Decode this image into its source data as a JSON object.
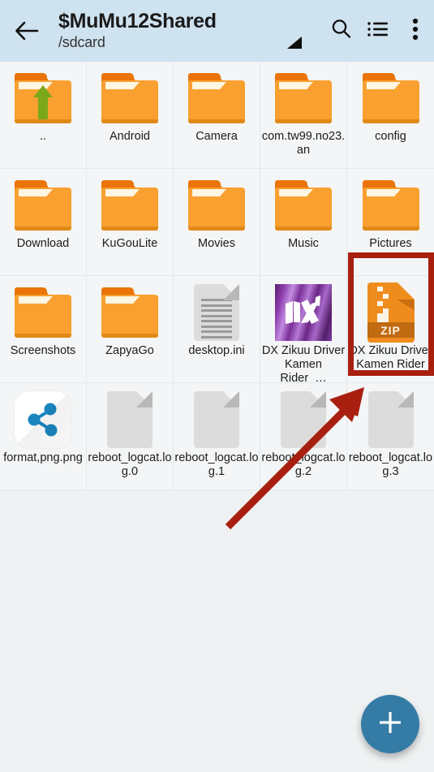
{
  "header": {
    "back_icon": "arrow-left-icon",
    "title": "$MuMu12Shared",
    "subtitle": "/sdcard",
    "search_icon": "search-icon",
    "list_view_icon": "list-view-icon",
    "overflow_icon": "more-vertical-icon",
    "background_color": "#cfe2f0"
  },
  "grid": {
    "columns": 5,
    "items": [
      {
        "label": "..",
        "icon": "folder-up-icon",
        "type": "folder-parent"
      },
      {
        "label": "Android",
        "icon": "folder-icon",
        "type": "folder"
      },
      {
        "label": "Camera",
        "icon": "folder-icon",
        "type": "folder"
      },
      {
        "label": "com.tw99.no23.an",
        "icon": "folder-icon",
        "type": "folder"
      },
      {
        "label": "config",
        "icon": "folder-icon",
        "type": "folder"
      },
      {
        "label": "Download",
        "icon": "folder-icon",
        "type": "folder"
      },
      {
        "label": "KuGouLite",
        "icon": "folder-icon",
        "type": "folder"
      },
      {
        "label": "Movies",
        "icon": "folder-icon",
        "type": "folder"
      },
      {
        "label": "Music",
        "icon": "folder-icon",
        "type": "folder"
      },
      {
        "label": "Pictures",
        "icon": "folder-icon",
        "type": "folder"
      },
      {
        "label": "Screenshots",
        "icon": "folder-icon",
        "type": "folder"
      },
      {
        "label": "ZapyaGo",
        "icon": "folder-icon",
        "type": "folder"
      },
      {
        "label": "desktop.ini",
        "icon": "text-file-icon",
        "type": "file"
      },
      {
        "label": "DX Zikuu Driver Kamen Rider_…",
        "icon": "image-thumbnail",
        "type": "image"
      },
      {
        "label": "DX Zikuu Driver Kamen Rider",
        "icon": "zip-file-icon",
        "type": "archive",
        "badge": "ZIP",
        "highlighted": true
      },
      {
        "label": "format,png.png",
        "icon": "share-png-icon",
        "type": "image"
      },
      {
        "label": "reboot_logcat.log.0",
        "icon": "blank-file-icon",
        "type": "file"
      },
      {
        "label": "reboot_logcat.log.1",
        "icon": "blank-file-icon",
        "type": "file"
      },
      {
        "label": "reboot_logcat.log.2",
        "icon": "blank-file-icon",
        "type": "file"
      },
      {
        "label": "reboot_logcat.log.3",
        "icon": "blank-file-icon",
        "type": "file"
      }
    ]
  },
  "annotations": {
    "highlight_color": "#a81f10",
    "arrow_color": "#a81f10",
    "highlight_target": "DX Zikuu Driver Kamen Rider"
  },
  "fab": {
    "icon": "plus-icon",
    "color": "#347ba5"
  }
}
